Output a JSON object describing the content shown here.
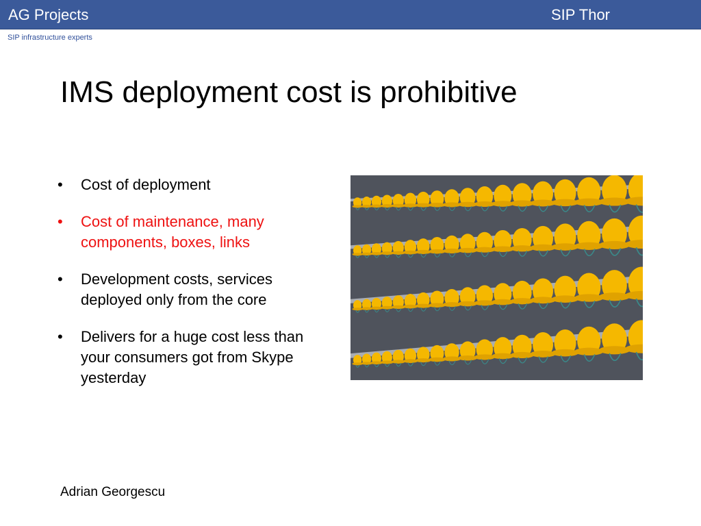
{
  "header": {
    "left_title": "AG Projects",
    "right_title": "SIP Thor",
    "background": "#3b5a9a"
  },
  "tagline": "SIP infrastructure experts",
  "slide": {
    "title": "IMS deployment cost is prohibitive",
    "bullets": [
      {
        "text": "Cost of deployment",
        "color": "#000000"
      },
      {
        "text": "Cost of maintenance, many components, boxes, links",
        "color": "#ee1111"
      },
      {
        "text": "Development costs, services deployed only from the core",
        "color": "#000000"
      },
      {
        "text": "Delivers for a huge cost less than your consumers got from Skype yesterday",
        "color": "#000000"
      }
    ],
    "bullet_glyph": "•",
    "photo": {
      "subject": "rows of yellow hard hats on metal shelves",
      "hat_color": "#f5b800",
      "strap_color": "#3a8a8a"
    }
  },
  "footer": {
    "author": "Adrian Georgescu"
  }
}
